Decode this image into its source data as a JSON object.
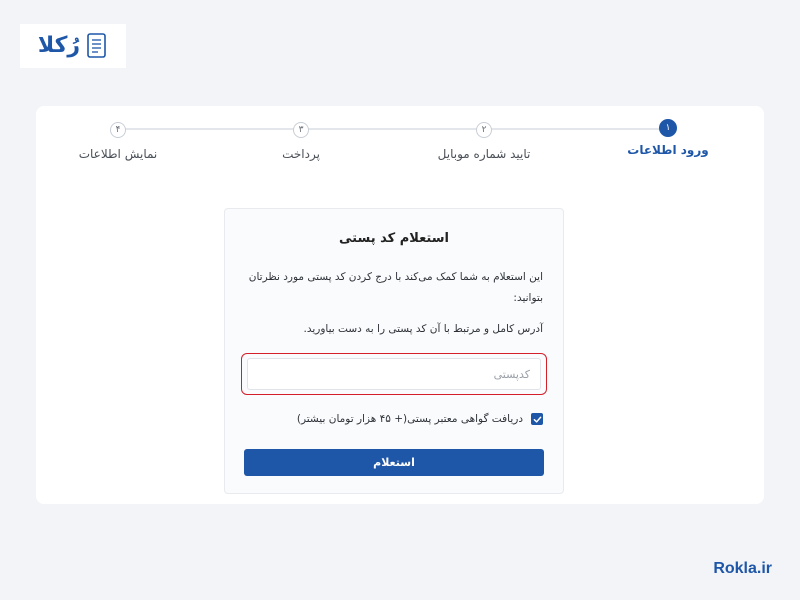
{
  "logo": {
    "text": "رُکلا",
    "icon": "document-icon"
  },
  "steps": [
    {
      "number": "۱",
      "label": "ورود اطلاعات",
      "active": true
    },
    {
      "number": "۲",
      "label": "تایید شماره موبایل",
      "active": false
    },
    {
      "number": "۳",
      "label": "پرداخت",
      "active": false
    },
    {
      "number": "۴",
      "label": "نمایش اطلاعات",
      "active": false
    }
  ],
  "form": {
    "title": "استعلام کد پستی",
    "description_1": "این استعلام به شما کمک می‌کند با درج کردن کد پستی مورد نظرتان بتوانید:",
    "description_2": "آدرس کامل و مرتبط با آن کد پستی را به دست بیاورید.",
    "postal_placeholder": "کدپستی",
    "postal_value": "",
    "certificate_label": "دریافت گواهی معتبر پستی(+ ۴۵ هزار تومان بیشتر)",
    "certificate_checked": true,
    "submit_label": "استعلام"
  },
  "colors": {
    "primary": "#1e56a8",
    "highlight": "#d41f2a"
  },
  "brand": "Rokla.ir"
}
